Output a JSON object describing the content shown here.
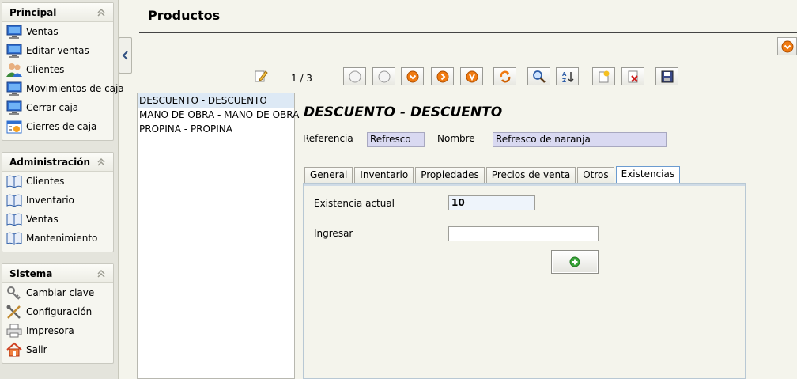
{
  "page_title": "Productos",
  "sidebar": {
    "sections": [
      {
        "title": "Principal",
        "items": [
          {
            "label": "Ventas",
            "icon": "monitor-icon"
          },
          {
            "label": "Editar ventas",
            "icon": "monitor-icon"
          },
          {
            "label": "Clientes",
            "icon": "users-icon"
          },
          {
            "label": "Movimientos de caja",
            "icon": "monitor-icon"
          },
          {
            "label": "Cerrar caja",
            "icon": "monitor-icon"
          },
          {
            "label": "Cierres de caja",
            "icon": "calendar-icon"
          }
        ]
      },
      {
        "title": "Administración",
        "items": [
          {
            "label": "Clientes",
            "icon": "book-icon"
          },
          {
            "label": "Inventario",
            "icon": "book-icon"
          },
          {
            "label": "Ventas",
            "icon": "book-icon"
          },
          {
            "label": "Mantenimiento",
            "icon": "book-icon"
          }
        ]
      },
      {
        "title": "Sistema",
        "items": [
          {
            "label": "Cambiar clave",
            "icon": "key-icon"
          },
          {
            "label": "Configuración",
            "icon": "tools-icon"
          },
          {
            "label": "Impresora",
            "icon": "printer-icon"
          },
          {
            "label": "Salir",
            "icon": "home-exit-icon"
          }
        ]
      }
    ]
  },
  "toolbar": {
    "pager": "1 / 3",
    "buttons": [
      "first-record-icon",
      "previous-record-icon",
      "next-record-icon",
      "next-page-icon",
      "last-record-icon",
      "reload-icon",
      "search-icon",
      "sort-icon",
      "new-record-icon",
      "delete-record-icon",
      "save-icon"
    ]
  },
  "list": {
    "items": [
      "DESCUENTO - DESCUENTO",
      "MANO DE OBRA - MANO DE OBRA",
      "PROPINA - PROPINA"
    ],
    "selected": 0
  },
  "detail": {
    "title": "DESCUENTO - DESCUENTO",
    "referencia_label": "Referencia",
    "referencia_value": "Refresco",
    "nombre_label": "Nombre",
    "nombre_value": "Refresco de naranja"
  },
  "tabs": [
    "General",
    "Inventario",
    "Propiedades",
    "Precios de venta",
    "Otros",
    "Existencias"
  ],
  "active_tab": 5,
  "existencias": {
    "actual_label": "Existencia actual",
    "actual_value": "10",
    "ingresar_label": "Ingresar",
    "ingresar_value": ""
  },
  "colors": {
    "accent_orange": "#f07a10",
    "readonly_field": "#d9d9f1",
    "list_selection": "#dde9f5",
    "add_green": "#3aa53a"
  }
}
